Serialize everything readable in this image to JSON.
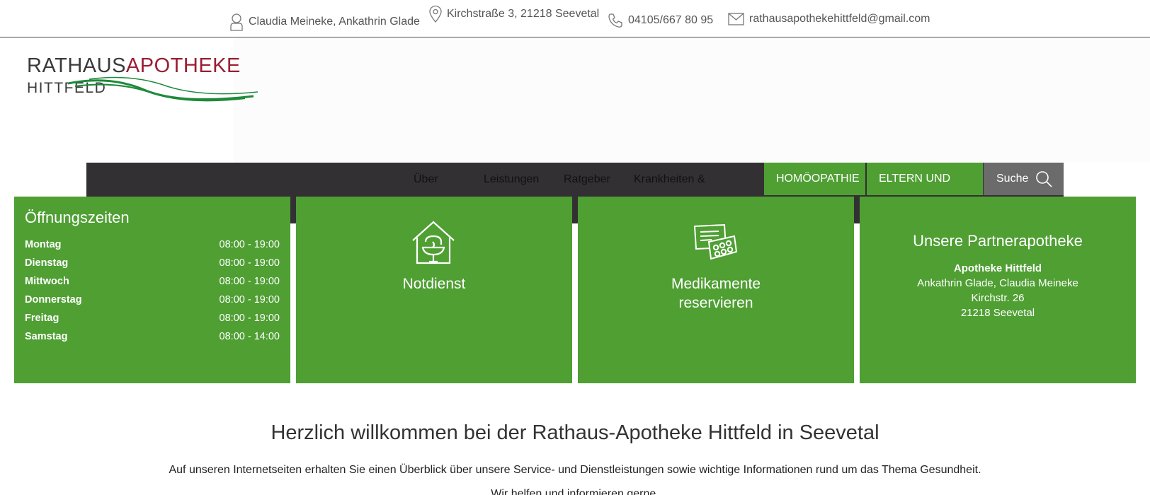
{
  "topbar": {
    "owners": "Claudia Meineke, Ankathrin Glade",
    "address": "Kirchstraße 3, 21218 Seevetal",
    "phone": "04105/667 80 95",
    "email": "rathausapothekehittfeld@gmail.com"
  },
  "logo": {
    "part1": "RATHAUS",
    "part2": "APOTHEKE",
    "part3": "HITTFELD"
  },
  "nav": {
    "items": [
      "Über",
      "Leistungen",
      "Ratgeber",
      "Krankheiten &"
    ],
    "tab_homoeopathie": "HOMÖOPATHIE",
    "tab_eltern": "ELTERN UND",
    "search": "Suche"
  },
  "hours": {
    "title": "Öffnungszeiten",
    "rows": [
      {
        "day": "Montag",
        "time": "08:00 - 19:00"
      },
      {
        "day": "Dienstag",
        "time": "08:00 - 19:00"
      },
      {
        "day": "Mittwoch",
        "time": "08:00 - 19:00"
      },
      {
        "day": "Donnerstag",
        "time": "08:00 - 19:00"
      },
      {
        "day": "Freitag",
        "time": "08:00 - 19:00"
      },
      {
        "day": "Samstag",
        "time": "08:00 - 14:00"
      }
    ]
  },
  "notdienst": {
    "title": "Notdienst"
  },
  "reservieren": {
    "line1": "Medikamente",
    "line2": "reservieren"
  },
  "partner": {
    "title": "Unsere Partnerapotheke",
    "name": "Apotheke Hittfeld",
    "owners": "Ankathrin Glade, Claudia Meineke",
    "street": "Kirchstr. 26",
    "city": "21218 Seevetal"
  },
  "welcome": {
    "title": "Herzlich willkommen bei der Rathaus-Apotheke Hittfeld in Seevetal",
    "text": "Auf unseren Internetseiten erhalten Sie einen Überblick über unsere Service- und Dienstleistungen sowie wichtige Informationen rund um das Thema Gesundheit.",
    "text2": "Wir helfen und informieren gerne."
  },
  "colors": {
    "green": "#4f9f33",
    "dark_nav": "#333033",
    "logo_red": "#9a1f33",
    "logo_green": "#1e8a3a"
  }
}
